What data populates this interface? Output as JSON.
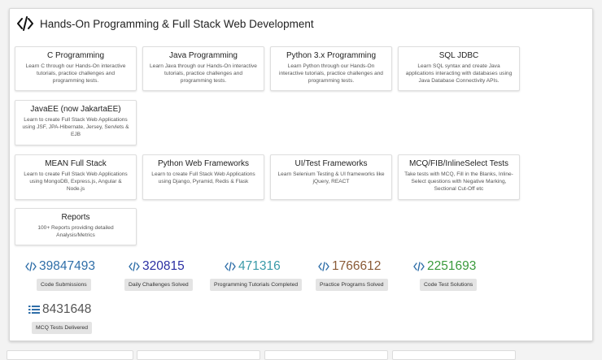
{
  "panel": {
    "title": "Hands-On Programming & Full Stack Web Development",
    "icon": "code-icon"
  },
  "cards": [
    {
      "title": "C Programming",
      "desc": "Learn C through our Hands-On interactive tutorials, practice challenges and programming tests."
    },
    {
      "title": "Java Programming",
      "desc": "Learn Java through our Hands-On interactive tutorials, practice challenges and programming tests."
    },
    {
      "title": "Python 3.x Programming",
      "desc": "Learn Python through our Hands-On interactive tutorials, practice challenges and programming tests."
    },
    {
      "title": "SQL JDBC",
      "desc": "Learn SQL syntax and create Java applications interacting with databases using Java Database Connectivity APIs."
    },
    {
      "title": "JavaEE (now JakartaEE)",
      "desc": "Learn to create Full Stack Web Applications using JSF, JPA-Hibernate, Jersey, Servlets & EJB"
    },
    {
      "title": "MEAN Full Stack",
      "desc": "Learn to create Full Stack Web Applications using MongoDB, Express.js, Angular & Node.js"
    },
    {
      "title": "Python Web Frameworks",
      "desc": "Learn to create Full Stack Web Applications using Django, Pyramid, Redis & Flask"
    },
    {
      "title": "UI/Test Frameworks",
      "desc": "Learn Selenium Testing & UI frameworks like jQuery, REACT"
    },
    {
      "title": "MCQ/FIB/InlineSelect Tests",
      "desc": "Take tests with MCQ, Fill in the Blanks, Inline-Select questions with Negative Marking, Sectional Cut-Off etc"
    },
    {
      "title": "Reports",
      "desc": "100+ Reports providing detailed Analysis/Metrics"
    }
  ],
  "stats": [
    {
      "value": "39847493",
      "label": "Code Submissions",
      "color": "#2f6ea8",
      "icon": "code-icon"
    },
    {
      "value": "320815",
      "label": "Daily Challenges Solved",
      "color": "#2b2fa3",
      "icon": "code-icon"
    },
    {
      "value": "471316",
      "label": "Programming Tutorials Completed",
      "color": "#3a9aa8",
      "icon": "code-icon"
    },
    {
      "value": "1766612",
      "label": "Practice Programs Solved",
      "color": "#8a5a36",
      "icon": "code-icon"
    },
    {
      "value": "2251693",
      "label": "Code Test Solutions",
      "color": "#3a9a3c",
      "icon": "code-icon"
    },
    {
      "value": "8431648",
      "label": "MCQ Tests Delivered",
      "color": "#555555",
      "icon": "list-icon"
    }
  ],
  "colors": {
    "icon_blue": "#2f6ea8",
    "list_icon": "#2f6ea8"
  }
}
